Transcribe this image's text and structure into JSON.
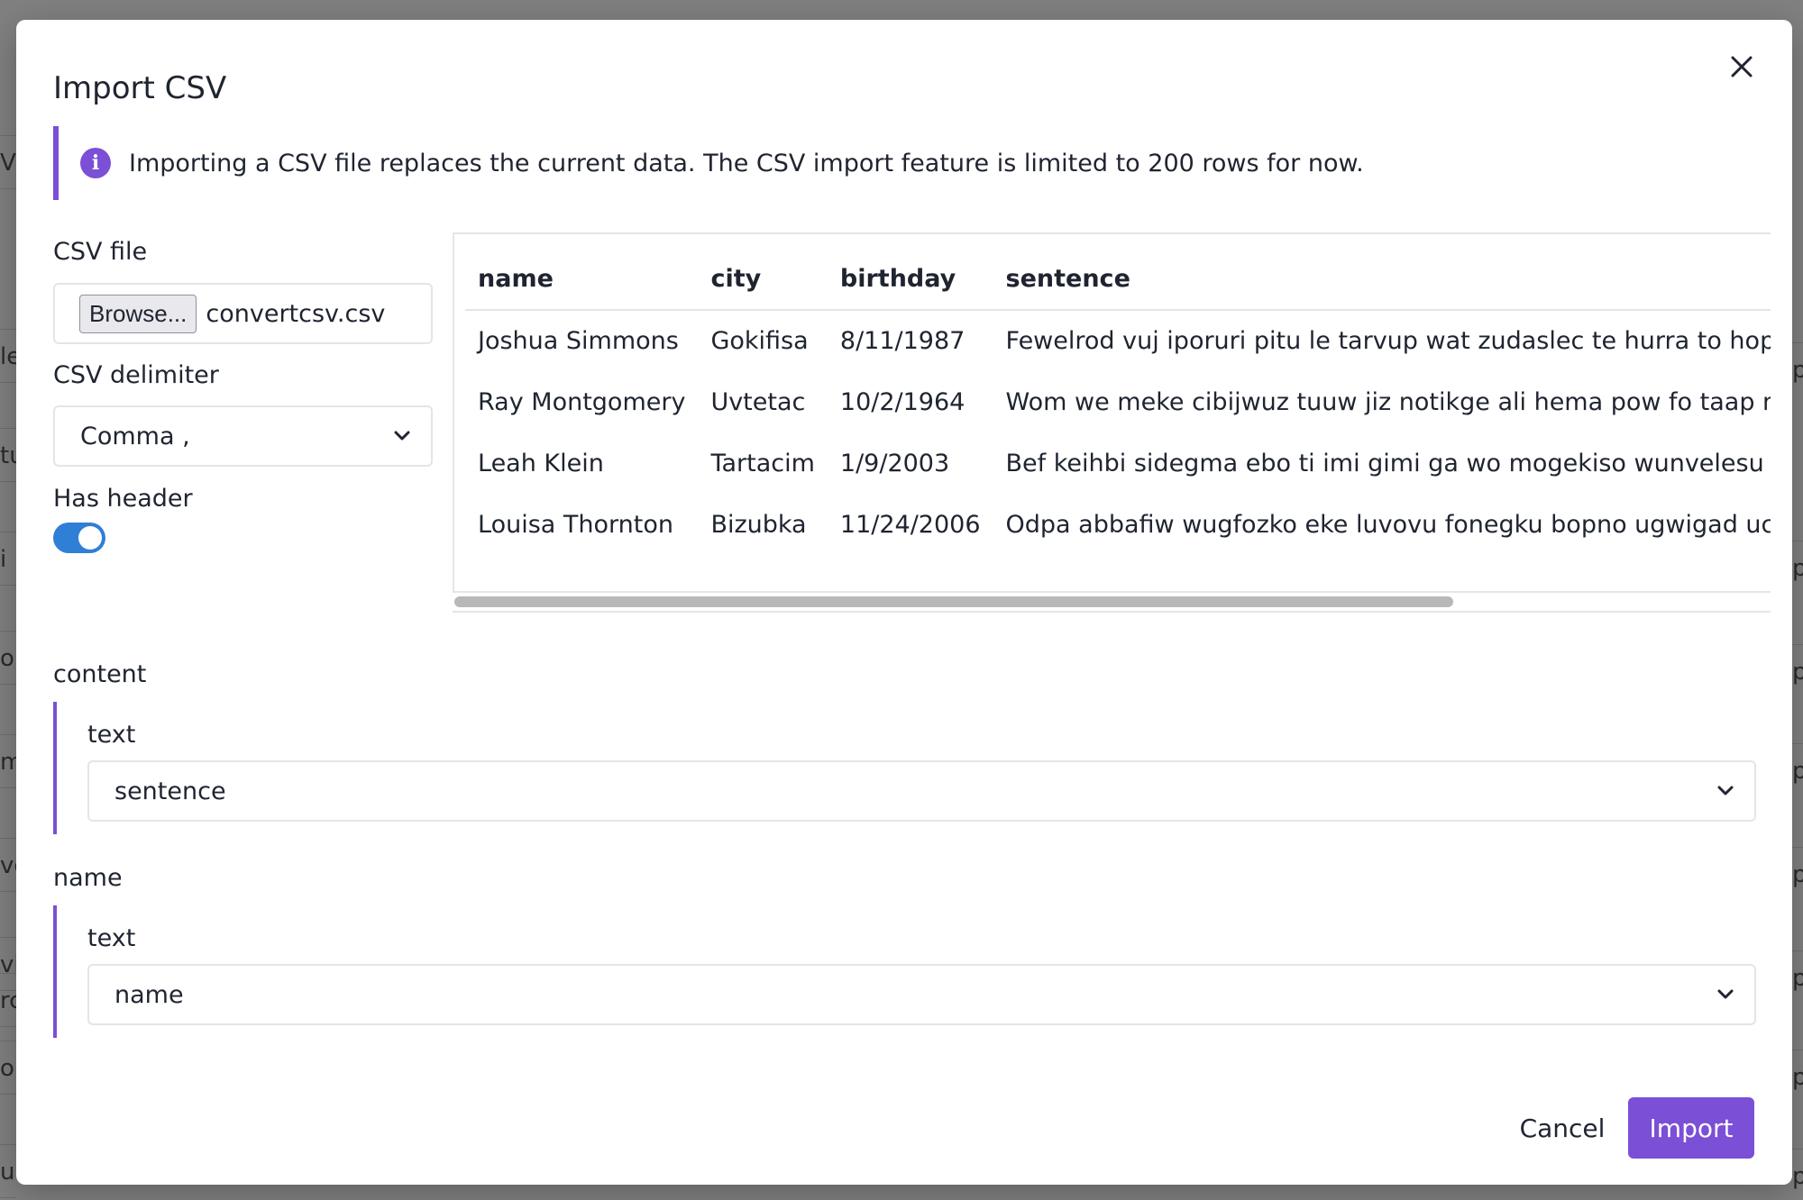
{
  "background": {
    "left_fragments": [
      "V",
      "le",
      "tu",
      "i i",
      "o e",
      "m",
      "vo",
      "vis",
      "rc",
      "ob",
      "u"
    ],
    "right_fragments": [
      "p",
      "p",
      "p",
      "p",
      "p",
      "p",
      "p",
      "p"
    ]
  },
  "dialog": {
    "title": "Import CSV",
    "close_icon": "close-icon",
    "info": {
      "icon": "info-icon",
      "icon_glyph": "i",
      "text": "Importing a CSV file replaces the current data. The CSV import feature is limited to 200 rows for now."
    },
    "csv_file": {
      "label": "CSV file",
      "browse_label": "Browse...",
      "file_name": "convertcsv.csv"
    },
    "delimiter": {
      "label": "CSV delimiter",
      "value": "Comma ,"
    },
    "has_header": {
      "label": "Has header",
      "enabled": true
    },
    "preview": {
      "columns": [
        "name",
        "city",
        "birthday",
        "sentence"
      ],
      "rows": [
        [
          "Joshua Simmons",
          "Gokifisa",
          "8/11/1987",
          "Fewelrod vuj iporuri pitu le tarvup wat zudaslec te hurra to hopjavro"
        ],
        [
          "Ray Montgomery",
          "Uvtetac",
          "10/2/1964",
          "Wom we meke cibijwuz tuuw jiz notikge ali hema pow fo taap nukaf"
        ],
        [
          "Leah Klein",
          "Tartacim",
          "1/9/2003",
          "Bef keihbi sidegma ebo ti imi gimi ga wo mogekiso wunvelesu ku bi c"
        ],
        [
          "Louisa Thornton",
          "Bizubka",
          "11/24/2006",
          "Odpa abbafiw wugfozko eke luvovu fonegku bopno ugwigad uc ufe"
        ]
      ],
      "scroll_fraction": 0.76
    },
    "mappings": [
      {
        "field": "content",
        "type_label": "text",
        "selected": "sentence"
      },
      {
        "field": "name",
        "type_label": "text",
        "selected": "name"
      }
    ],
    "footer": {
      "cancel_label": "Cancel",
      "import_label": "Import"
    },
    "colors": {
      "accent": "#7b4fd6",
      "toggle_on": "#2f7fd6",
      "overlay": "#808080"
    }
  }
}
